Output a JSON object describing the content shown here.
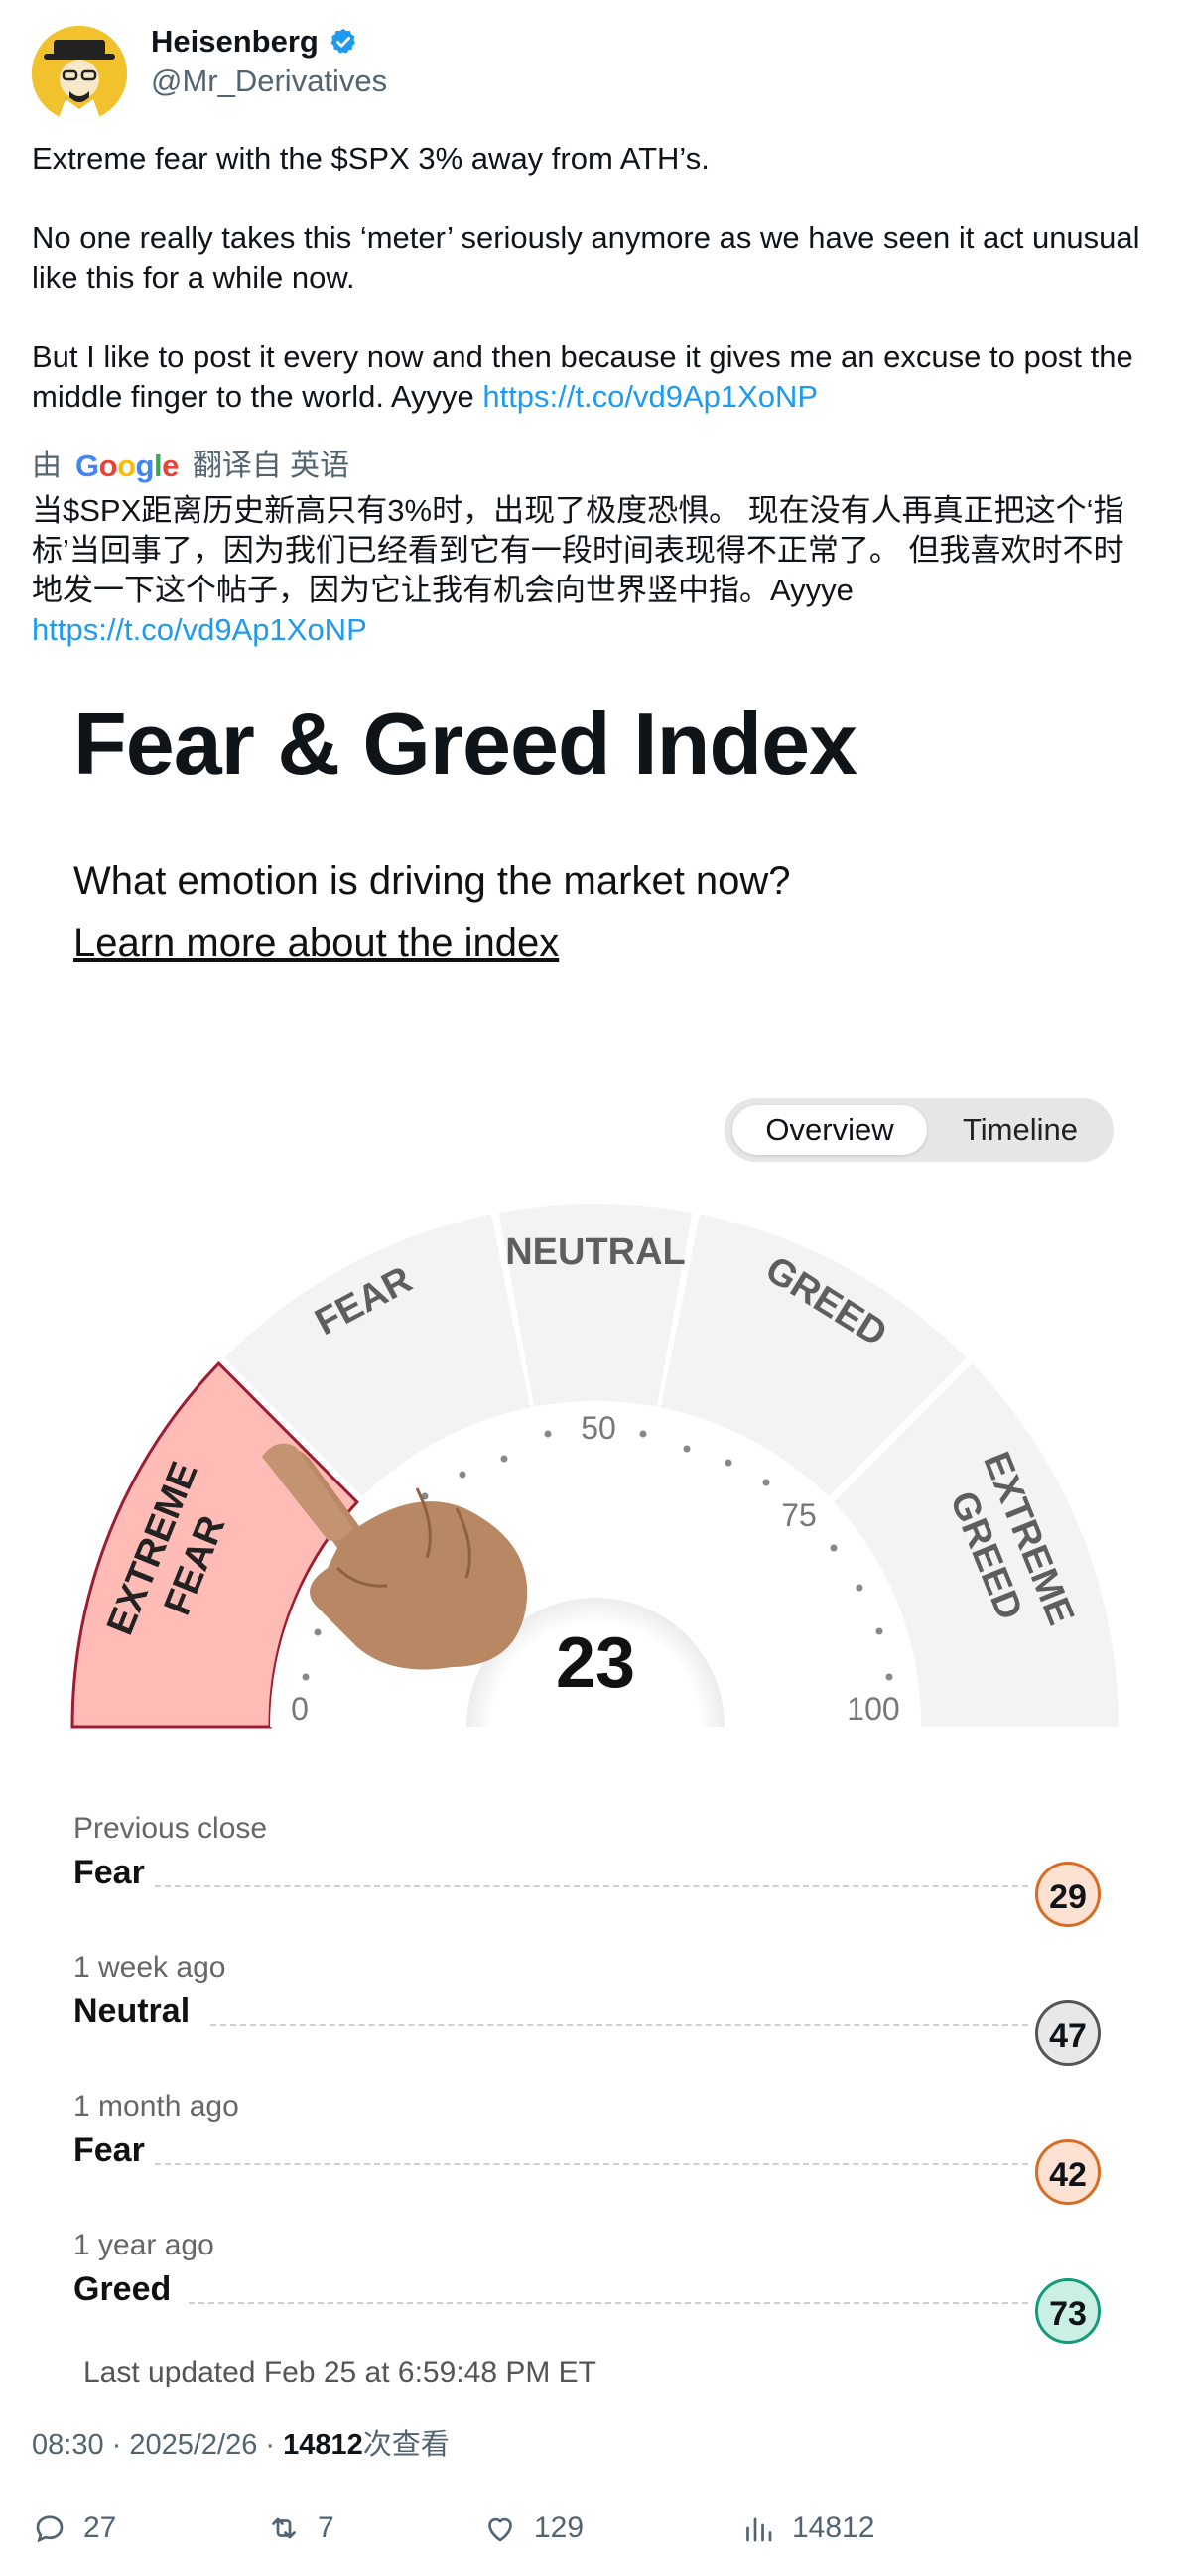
{
  "author": {
    "name": "Heisenberg",
    "handle": "@Mr_Derivatives",
    "verified": true,
    "avatar_icon": "heisenberg-avatar"
  },
  "tweet": {
    "text_main": "Extreme fear with the $SPX 3% away from ATH’s.\n\nNo one really takes this ‘meter’ seriously anymore as we have seen it act unusual like this for a while now.\n\nBut I like to post it every now and then because it gives me an excuse to post the middle finger to the world. Ayyye ",
    "link": "https://t.co/vd9Ap1XoNP",
    "translate_prefix": "由",
    "translate_brand": "Google",
    "translate_suffix": "翻译自 英语",
    "translation_text": "当$SPX距离历史新高只有3%时，出现了极度恐惧。 现在没有人再真正把这个‘指标’当回事了，因为我们已经看到它有一段时间表现得不正常了。 但我喜欢时不时地发一下这个帖子，因为它让我有机会向世界竖中指。Ayyye\n",
    "translation_link": "https://t.co/vd9Ap1XoNP"
  },
  "media": {
    "title": "Fear & Greed Index",
    "subtitle": "What emotion is driving the market now?",
    "learn_link": "Learn more about the index",
    "tabs": [
      "Overview",
      "Timeline"
    ],
    "gauge": {
      "value": 23,
      "segments": [
        "EXTREME FEAR",
        "FEAR",
        "NEUTRAL",
        "GREED",
        "EXTREME GREED"
      ],
      "active_segment": "EXTREME FEAR",
      "ticks": [
        "0",
        "25",
        "50",
        "75",
        "100"
      ],
      "tick_labels_visible": [
        "0",
        "50",
        "75",
        "100"
      ],
      "colors": {
        "active": "#ffbcb6",
        "active_border": "#9e1b32",
        "inactive": "#f3f3f3"
      }
    },
    "history": [
      {
        "label": "Previous close",
        "rating": "Fear",
        "value": "29",
        "bg": "#fde1d3",
        "border": "#d96b22"
      },
      {
        "label": "1 week ago",
        "rating": "Neutral",
        "value": "47",
        "bg": "#e8e8e8",
        "border": "#555555"
      },
      {
        "label": "1 month ago",
        "rating": "Fear",
        "value": "42",
        "bg": "#fde1d3",
        "border": "#d96b22"
      },
      {
        "label": "1 year ago",
        "rating": "Greed",
        "value": "73",
        "bg": "#c9f0e3",
        "border": "#139a7a"
      }
    ],
    "updated": "Last updated Feb 25 at 6:59:48 PM ET"
  },
  "meta": {
    "time": "08:30 · 2025/2/26 · ",
    "views_count": "14812",
    "views_label": "次查看"
  },
  "actions": {
    "replies": "27",
    "retweets": "7",
    "likes": "129",
    "views": "14812"
  }
}
